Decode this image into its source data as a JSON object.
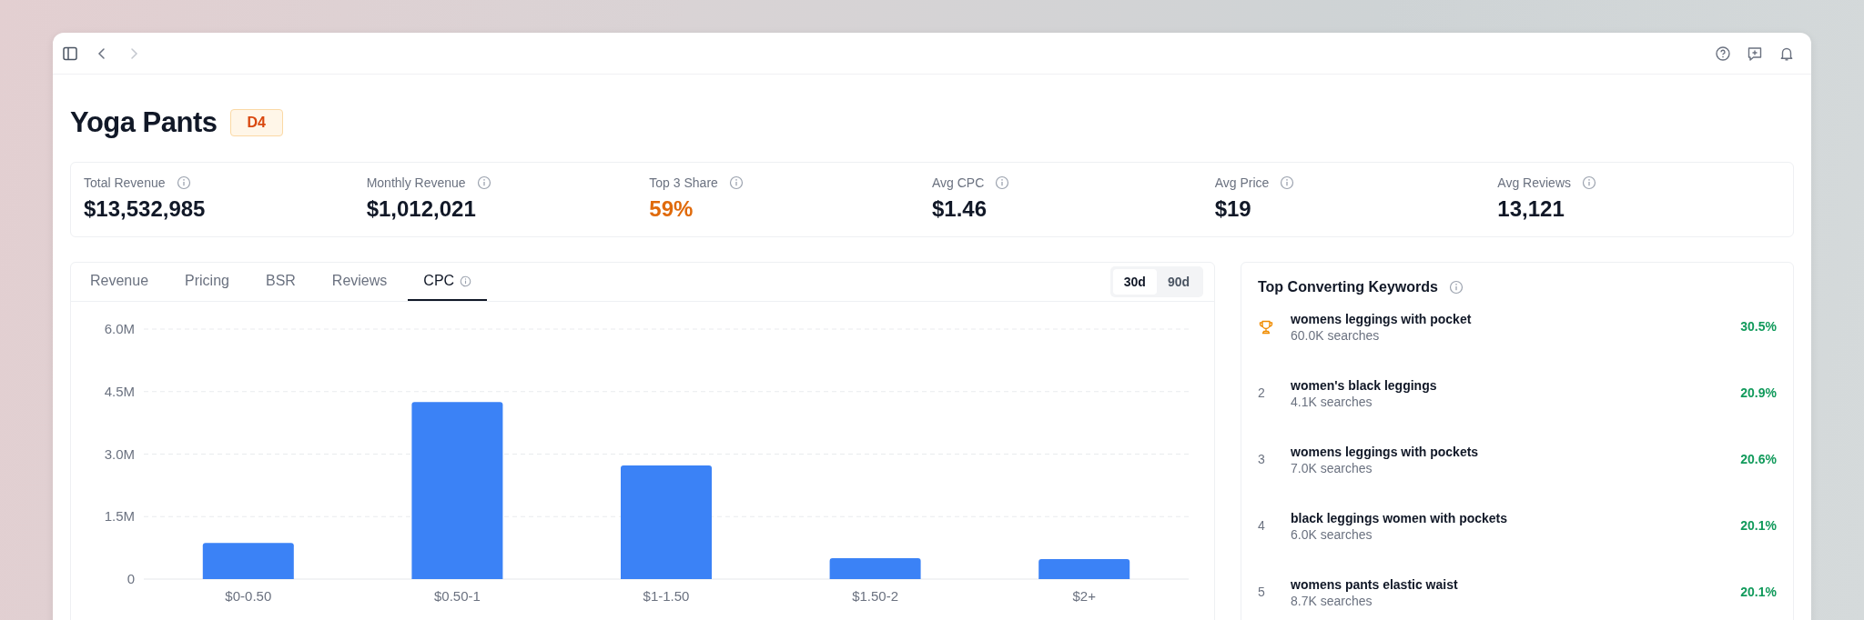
{
  "toolbar": {
    "back_disabled": false,
    "forward_disabled": true
  },
  "header": {
    "title": "Yoga Pants",
    "badge": "D4"
  },
  "stats": [
    {
      "label": "Total Revenue",
      "value": "$13,532,985",
      "color": "#111827"
    },
    {
      "label": "Monthly Revenue",
      "value": "$1,012,021",
      "color": "#111827"
    },
    {
      "label": "Top 3 Share",
      "value": "59%",
      "color": "#e06a0b"
    },
    {
      "label": "Avg CPC",
      "value": "$1.46",
      "color": "#111827"
    },
    {
      "label": "Avg Price",
      "value": "$19",
      "color": "#111827"
    },
    {
      "label": "Avg Reviews",
      "value": "13,121",
      "color": "#111827"
    }
  ],
  "tabs": [
    {
      "label": "Revenue",
      "selected": false,
      "info": false
    },
    {
      "label": "Pricing",
      "selected": false,
      "info": false
    },
    {
      "label": "BSR",
      "selected": false,
      "info": false
    },
    {
      "label": "Reviews",
      "selected": false,
      "info": false
    },
    {
      "label": "CPC",
      "selected": true,
      "info": true
    }
  ],
  "periods": [
    {
      "label": "30d",
      "selected": true
    },
    {
      "label": "90d",
      "selected": false
    }
  ],
  "chart_data": {
    "type": "bar",
    "categories": [
      "$0-0.50",
      "$0.50-1",
      "$1-1.50",
      "$1.50-2",
      "$2+"
    ],
    "grid": true,
    "series": [
      {
        "color": "#3b82f6",
        "values": [
          870000,
          4250000,
          2730000,
          500000,
          480000
        ]
      }
    ],
    "ylim": [
      0,
      6000000
    ],
    "yticks": [
      {
        "value": 0,
        "label": "0"
      },
      {
        "value": 1500000,
        "label": "1.5M"
      },
      {
        "value": 3000000,
        "label": "3.0M"
      },
      {
        "value": 4500000,
        "label": "4.5M"
      },
      {
        "value": 6000000,
        "label": "6.0M"
      }
    ]
  },
  "keywords": {
    "title": "Top Converting Keywords",
    "items": [
      {
        "kind": "trophy",
        "keyword": "womens leggings with pocket",
        "searches": "60.0K searches",
        "rate": "30.5%"
      },
      {
        "kind": "number",
        "rank": "2",
        "keyword": "women's black leggings",
        "searches": "4.1K searches",
        "rate": "20.9%"
      },
      {
        "kind": "number",
        "rank": "3",
        "keyword": "womens leggings with pockets",
        "searches": "7.0K searches",
        "rate": "20.6%"
      },
      {
        "kind": "number",
        "rank": "4",
        "keyword": "black leggings women with pockets",
        "searches": "6.0K searches",
        "rate": "20.1%"
      },
      {
        "kind": "number",
        "rank": "5",
        "keyword": "womens pants elastic waist",
        "searches": "8.7K searches",
        "rate": "20.1%"
      }
    ]
  }
}
